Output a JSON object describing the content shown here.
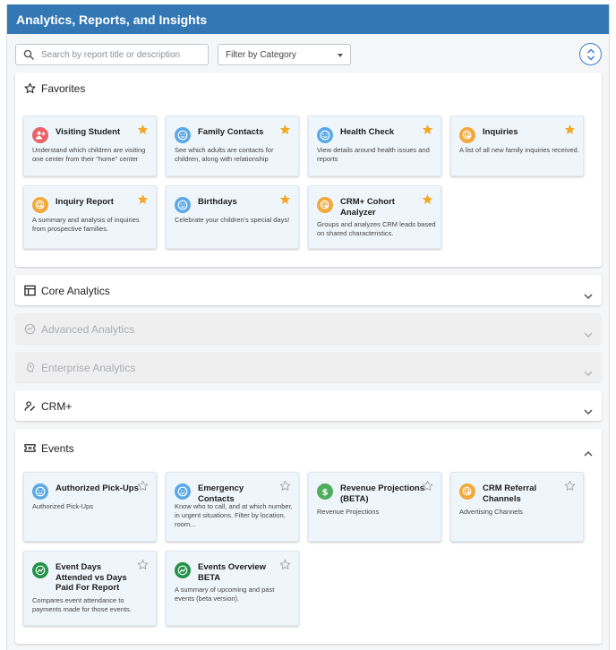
{
  "app": {
    "title": "Analytics, Reports, and Insights"
  },
  "toolbar": {
    "search_placeholder": "Search by report title or description",
    "filter_label": "Filter by Category"
  },
  "sections": {
    "favorites": {
      "title": "Favorites"
    },
    "core": {
      "title": "Core Analytics"
    },
    "advanced": {
      "title": "Advanced Analytics"
    },
    "enterprise": {
      "title": "Enterprise Analytics"
    },
    "crm": {
      "title": "CRM+"
    },
    "events": {
      "title": "Events"
    }
  },
  "colors": {
    "accent": "#3378b4",
    "favorite_star": "#f5a623",
    "card_bg": "#eef6fc"
  },
  "favorites": [
    {
      "title": "Visiting Student",
      "desc": "Understand which children are visiting one center from their \"home\" center",
      "icon": "add-person-icon",
      "favorited": true
    },
    {
      "title": "Family Contacts",
      "desc": "See which adults are contacts for children, along with relationship",
      "icon": "smiley-icon",
      "favorited": true
    },
    {
      "title": "Health Check",
      "desc": "View details around health issues and reports",
      "icon": "smiley-icon",
      "favorited": true
    },
    {
      "title": "Inquiries",
      "desc": "A list of all new family inquiries received.",
      "icon": "pointer-icon",
      "favorited": true
    },
    {
      "title": "Inquiry Report",
      "desc": "A summary and analysis of inquiries from prospective families.",
      "icon": "pointer-icon",
      "favorited": true
    },
    {
      "title": "Birthdays",
      "desc": "Celebrate your children's special days!",
      "icon": "smiley-icon",
      "favorited": true
    },
    {
      "title": "CRM+ Cohort Analyzer",
      "desc": "Groups and analyzes CRM leads based on shared characteristics.",
      "icon": "pointer-icon",
      "favorited": true
    }
  ],
  "events": [
    {
      "title": "Authorized Pick-Ups",
      "desc": "Authorized Pick-Ups",
      "icon": "smiley-icon",
      "favorited": false
    },
    {
      "title": "Emergency Contacts",
      "desc": "Know who to call, and at which number, in urgent situations. Filter by location, room...",
      "icon": "smiley-icon",
      "favorited": false
    },
    {
      "title": "Revenue Projections (BETA)",
      "desc": "Revenue Projections",
      "icon": "dollar-icon",
      "favorited": false
    },
    {
      "title": "CRM Referral Channels",
      "desc": "Advertising Channels",
      "icon": "pointer-icon",
      "favorited": false
    },
    {
      "title": "Event Days Attended vs Days Paid For Report",
      "desc": "Compares event attendance to payments made for those events.",
      "icon": "trend-icon",
      "favorited": false
    },
    {
      "title": "Events Overview BETA",
      "desc": "A summary of upcoming and past events (beta version).",
      "icon": "trend-icon",
      "favorited": false
    }
  ]
}
